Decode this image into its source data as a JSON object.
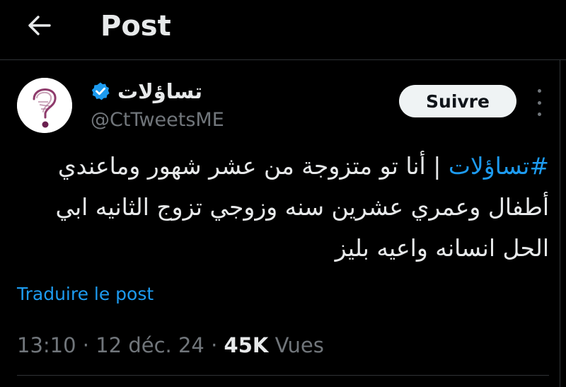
{
  "header": {
    "title": "Post"
  },
  "author": {
    "display_name": "تساؤلات",
    "handle": "@CtTweetsME",
    "verified": true
  },
  "follow_label": "Suivre",
  "post": {
    "hashtag": "#تساؤلات",
    "separator": " | ",
    "body": "أنا تو متزوجة من عشر شهور وماعندي أطفال وعمري عشرين سنه وزوجي تزوج الثانيه ابي الحل انسانه واعيه بليز"
  },
  "translate_label": "Traduire le post",
  "meta": {
    "time": "13:10",
    "dot1": " · ",
    "date": "12 déc. 24",
    "dot2": " · ",
    "views_count": "45K",
    "views_label": " Vues"
  },
  "colors": {
    "background": "#000000",
    "text_primary": "#e7e9ea",
    "text_secondary": "#71767b",
    "accent_blue": "#1d9bf0",
    "verified_blue": "#1d9bf0",
    "follow_bg": "#eff3f4",
    "avatar_accent": "#8e3a6b"
  },
  "icons": {
    "back": "arrow-left-icon",
    "verified": "verified-badge-icon",
    "more": "more-vertical-icon"
  }
}
